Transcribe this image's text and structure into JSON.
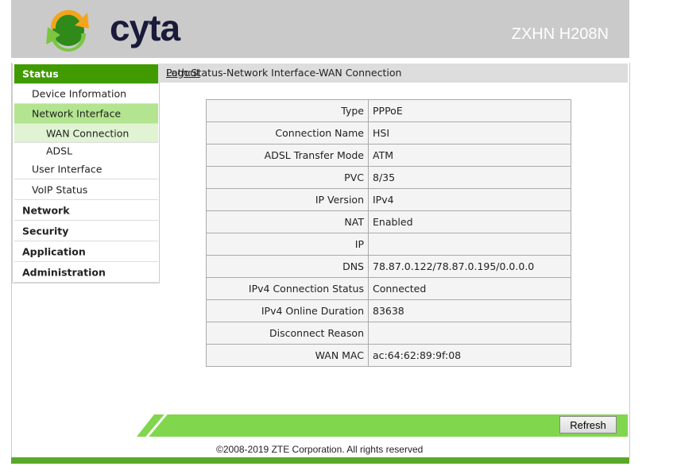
{
  "header": {
    "logo_text": "cyta",
    "model": "ZXHN H208N"
  },
  "sidebar": {
    "items": [
      {
        "label": "Status",
        "level": "top",
        "state": "active"
      },
      {
        "label": "Device Information",
        "level": "sub"
      },
      {
        "label": "Network Interface",
        "level": "sub",
        "state": "selected"
      },
      {
        "label": "WAN Connection",
        "level": "subsub",
        "state": "selected"
      },
      {
        "label": "ADSL",
        "level": "subsub"
      },
      {
        "label": "User Interface",
        "level": "sub"
      },
      {
        "label": "VoIP Status",
        "level": "sub"
      },
      {
        "label": "Network",
        "level": "top"
      },
      {
        "label": "Security",
        "level": "top"
      },
      {
        "label": "Application",
        "level": "top"
      },
      {
        "label": "Administration",
        "level": "top"
      }
    ]
  },
  "path": "Path:Status-Network Interface-WAN Connection",
  "logout": "Logout",
  "table": [
    {
      "label": "Type",
      "value": "PPPoE"
    },
    {
      "label": "Connection Name",
      "value": "HSI"
    },
    {
      "label": "ADSL Transfer Mode",
      "value": "ATM"
    },
    {
      "label": "PVC",
      "value": "8/35"
    },
    {
      "label": "IP Version",
      "value": "IPv4"
    },
    {
      "label": "NAT",
      "value": "Enabled"
    },
    {
      "label": "IP",
      "value": ""
    },
    {
      "label": "DNS",
      "value": "78.87.0.122/78.87.0.195/0.0.0.0"
    },
    {
      "label": "IPv4 Connection Status",
      "value": "Connected"
    },
    {
      "label": "IPv4 Online Duration",
      "value": "83638"
    },
    {
      "label": "Disconnect Reason",
      "value": ""
    },
    {
      "label": "WAN MAC",
      "value": "ac:64:62:89:9f:08"
    }
  ],
  "refresh": "Refresh",
  "footer": "©2008-2019 ZTE Corporation. All rights reserved"
}
